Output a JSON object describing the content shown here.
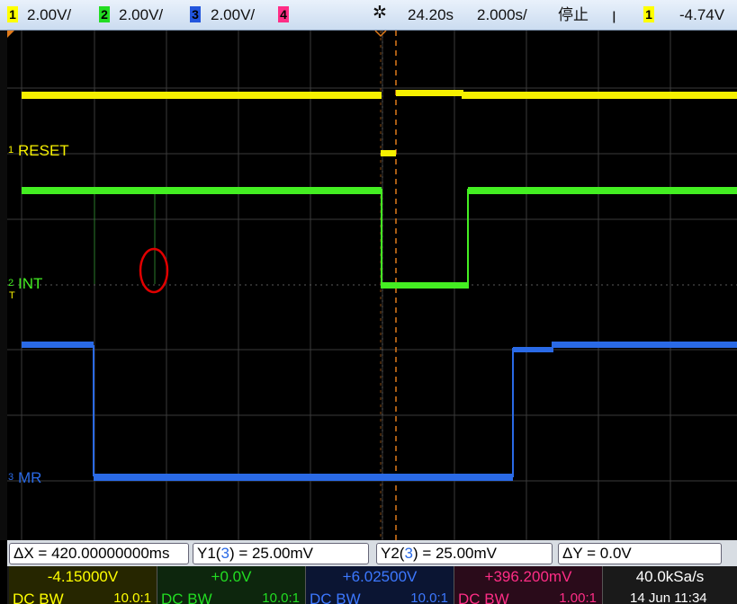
{
  "top": {
    "ch1_num": "1",
    "ch1_scale": "2.00V/",
    "ch2_num": "2",
    "ch2_scale": "2.00V/",
    "ch3_num": "3",
    "ch3_scale": "2.00V/",
    "ch4_num": "4",
    "trigger_icon": "✲",
    "time_delay": "24.20s",
    "time_scale": "2.000s/",
    "run_state": "停止",
    "trig_edge_icon": "ꞁ",
    "trig_ch": "1",
    "trig_level": "-4.74V"
  },
  "traces": {
    "ch1_label": "RESET",
    "ch2_label": "INT",
    "ch3_label": "MR",
    "ch1_num": "1",
    "ch2_num": "2",
    "ch3_num": "3",
    "trig_marker": "T"
  },
  "measure": {
    "delta_x": "ΔX = 420.00000000ms",
    "y1_prefix": "Y1(",
    "y1_ch": "3",
    "y1_suffix": ") = 25.00mV",
    "y2_prefix": "Y2(",
    "y2_ch": "3",
    "y2_suffix": ") = 25.00mV",
    "delta_y": "ΔY = 0.0V"
  },
  "channels": [
    {
      "value": "-4.15000V",
      "coupling": "DC BW",
      "probe": "10.0:1",
      "color": "#ffff00"
    },
    {
      "value": "+0.0V",
      "coupling": "DC BW",
      "probe": "10.0:1",
      "color": "#22dd22"
    },
    {
      "value": "+6.02500V",
      "coupling": "DC BW",
      "probe": "10.0:1",
      "color": "#3c78ff"
    },
    {
      "value": "+396.200mV",
      "coupling": "DC BW",
      "probe": "1.00:1",
      "color": "#ff2d86"
    }
  ],
  "acq": {
    "sample_rate": "40.0kSa/s",
    "date": "14 Jun 11:34"
  },
  "colors": {
    "ch1": "#f6f000",
    "ch2": "#44ee22",
    "ch3": "#2a6ae6",
    "ch4": "#ff2d86",
    "annotation": "#e00000"
  }
}
